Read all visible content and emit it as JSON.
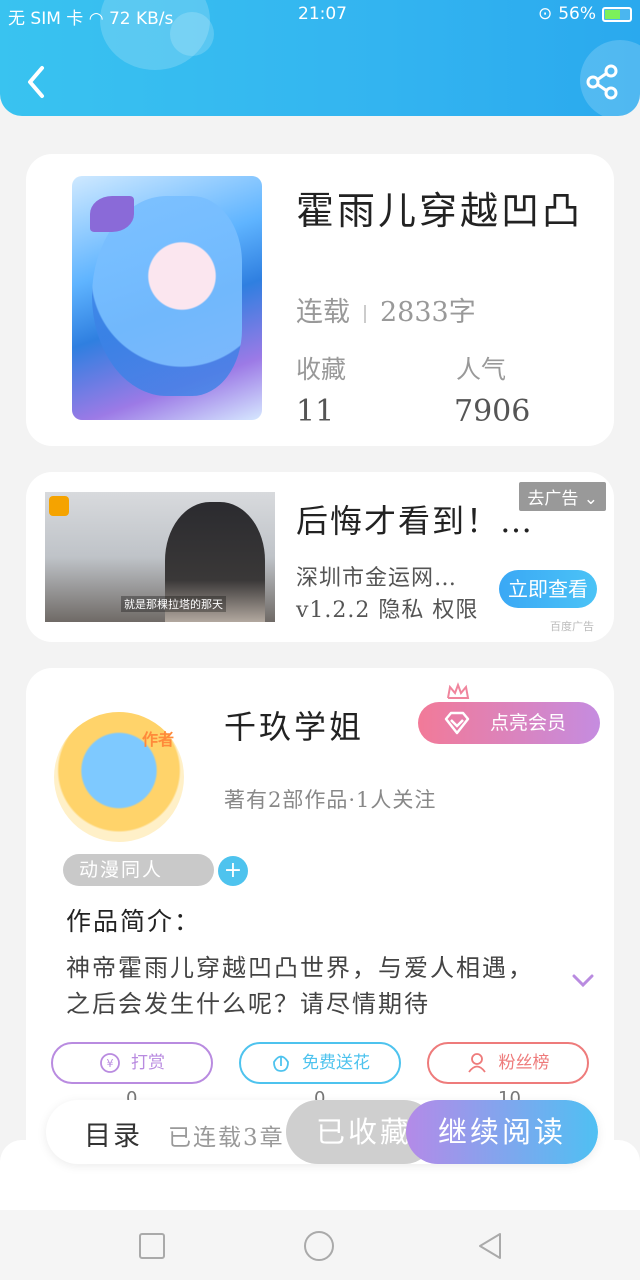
{
  "status_bar": {
    "carrier": "无 SIM 卡",
    "speed": "72 KB/s",
    "time": "21:07",
    "battery": "56%"
  },
  "book": {
    "title": "霍雨儿穿越凹凸",
    "status": "连载",
    "word_count": "2833字",
    "favorites_label": "收藏",
    "favorites_value": "11",
    "popularity_label": "人气",
    "popularity_value": "7906"
  },
  "ad": {
    "tag": "去广告",
    "title": "后悔才看到！…",
    "company": "深圳市金运网…",
    "version_line": "v1.2.2 隐私 权限",
    "button": "立即查看",
    "source": "百度广告",
    "image_caption": "就是那棵拉塔的那天"
  },
  "author": {
    "name": "千玖学姐",
    "avatar_tag": "作者",
    "vip_button": "点亮会员",
    "stats": "著有2部作品·1人关注",
    "genre": "动漫同人",
    "intro_label": "作品简介：",
    "intro_text": "神帝霍雨儿穿越凹凸世界，与爱人相遇，之后会发生什么呢？请尽情期待",
    "actions": [
      {
        "label": "打赏",
        "count": "0",
        "color": "#b98be0"
      },
      {
        "label": "免费送花",
        "count": "0",
        "color": "#4ec3ee"
      },
      {
        "label": "粉丝榜",
        "count": "10",
        "color": "#ee7b7b"
      }
    ]
  },
  "bottom_bar": {
    "toc": "目录",
    "toc_sub": "已连载3章",
    "collected": "已收藏",
    "continue": "继续阅读"
  }
}
